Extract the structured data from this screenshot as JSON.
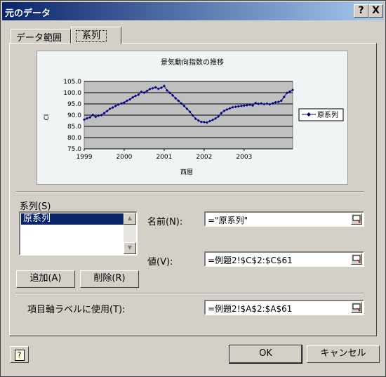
{
  "window": {
    "title": "元のデータ",
    "help_btn": "?",
    "close_btn": "X"
  },
  "tabs": [
    {
      "label": "データ範囲"
    },
    {
      "label": "系列"
    }
  ],
  "chart_data": {
    "type": "line",
    "title": "景気動向指数の推移",
    "xlabel": "西暦",
    "ylabel": "CI",
    "ylim": [
      75.0,
      105.0
    ],
    "yticks": [
      "105.0",
      "100.0",
      "95.0",
      "90.0",
      "85.0",
      "80.0",
      "75.0"
    ],
    "xtick_labels": [
      "1999",
      "2000",
      "2001",
      "2002",
      "2003"
    ],
    "legend_position": "right",
    "series": [
      {
        "name": "原系列",
        "color": "#000080",
        "values": [
          88.0,
          88.6,
          89.0,
          90.1,
          89.2,
          89.8,
          90.0,
          90.9,
          91.8,
          92.8,
          93.4,
          94.1,
          94.7,
          95.2,
          95.6,
          96.4,
          97.0,
          97.9,
          98.6,
          99.1,
          100.4,
          100.0,
          100.8,
          101.6,
          102.0,
          102.4,
          101.7,
          102.2,
          103.0,
          101.0,
          99.9,
          98.8,
          97.5,
          96.4,
          95.2,
          94.1,
          92.8,
          91.5,
          89.9,
          88.4,
          87.6,
          87.0,
          86.9,
          86.7,
          87.3,
          87.9,
          88.5,
          89.4,
          90.9,
          91.9,
          92.5,
          93.0,
          93.5,
          93.7,
          93.9,
          94.1,
          94.2,
          94.4,
          94.6,
          94.3,
          95.4,
          95.0,
          95.2,
          94.9,
          95.1,
          94.8,
          95.2,
          95.7,
          95.9,
          96.4,
          98.1,
          99.9,
          100.5,
          101.2
        ]
      }
    ]
  },
  "series_section": {
    "label": "系列(S)",
    "items": [
      "原系列"
    ],
    "add_button": "追加(A)",
    "delete_button": "削除(R)"
  },
  "name_field": {
    "label": "名前(N):",
    "value": "=\"原系列\""
  },
  "value_field": {
    "label": "値(V):",
    "value": "=例題2!$C$2:$C$61"
  },
  "axis_label_field": {
    "label": "項目軸ラベルに使用(T):",
    "value": "=例題2!$A$2:$A$61"
  },
  "footer": {
    "ok": "OK",
    "cancel": "キャンセル",
    "help_icon": "?"
  }
}
